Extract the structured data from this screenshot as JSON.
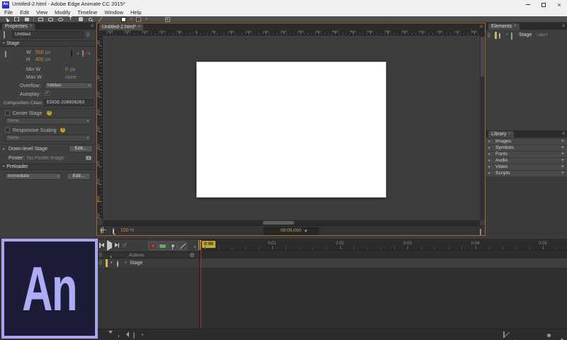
{
  "window": {
    "app_badge": "An",
    "title": "Untitled-2.html - Adobe Edge Animate CC 2015*"
  },
  "menu_bar": {
    "items": [
      "File",
      "Edit",
      "View",
      "Modify",
      "Timeline",
      "Window",
      "Help"
    ]
  },
  "ui": {
    "close_glyph": "×",
    "panel_menu_glyph": "-≡",
    "caret_down": "▾",
    "plus_glyph": "+",
    "bullet": "•",
    "braces": "{}",
    "diamond": "◆",
    "loop_glyph": "↺",
    "check_glyph": "✓",
    "help_glyph": "?",
    "text_tool_glyph": "T"
  },
  "properties_panel": {
    "tab_label": "Properties",
    "name_value": "Untitled",
    "stage_section_label": "Stage",
    "w_label": "W",
    "w_value": "550",
    "w_unit": "px",
    "h_label": "H",
    "h_value": "400",
    "h_unit": "px",
    "min_w_label": "Min W",
    "min_w_value": "0",
    "min_w_unit": "px",
    "max_w_label": "Max W",
    "max_w_value": "none",
    "overflow_label": "Overflow:",
    "overflow_value": "hidden",
    "autoplay_label": "Autoplay:",
    "composition_label": "Composition Class:",
    "composition_value": "EDGE-226926263",
    "center_stage_label": "Center Stage",
    "center_stage_dropdown": "None",
    "responsive_label": "Responsive Scaling",
    "responsive_dropdown": "None",
    "downlevel_label": "Down-level Stage",
    "downlevel_button": "Edit...",
    "poster_label": "Poster:",
    "poster_value": "No Poster Image",
    "preloader_section_label": "Preloader",
    "preloader_dropdown": "Immediate",
    "preloader_button": "Edit..."
  },
  "document_panel": {
    "tab_label": "Untitled-2.html*",
    "h_ruler_labels": [
      -250,
      -200,
      -150,
      -100,
      -50,
      0,
      50,
      100,
      150,
      200,
      250,
      300,
      350,
      400,
      450,
      500,
      550,
      600,
      650,
      700,
      750,
      800
    ],
    "v_ruler_labels": [
      -50,
      0,
      50,
      100,
      150,
      200,
      250,
      300,
      350,
      400,
      450
    ],
    "status": {
      "zoom_value": "100",
      "zoom_unit": "%",
      "timecode": "00:00,000"
    }
  },
  "elements_panel": {
    "tab_label": "Elements",
    "rows": [
      {
        "label": "Stage",
        "tag": "<div>"
      }
    ]
  },
  "library_panel": {
    "tab_label": "Library",
    "sections": [
      "Images",
      "Symbols",
      "Fonts",
      "Audio",
      "Video",
      "Scripts"
    ]
  },
  "timeline_panel": {
    "actions_label": "Actions",
    "playhead_label": "0:00",
    "second_labels": [
      "0:01",
      "0:02",
      "0:03",
      "0:04",
      "0:05"
    ],
    "rows": [
      {
        "label": "Stage"
      }
    ]
  },
  "logo": {
    "text": "An"
  },
  "colors": {
    "accent_value": "#cf8a3b",
    "focus_border": "#a4651c",
    "playhead_red": "#ad2e2e",
    "keyframe_yellow": "#d2b44c",
    "logo_bg": "#1c1c39",
    "logo_border": "#a5a5f0",
    "logo_text": "#adadf5"
  }
}
